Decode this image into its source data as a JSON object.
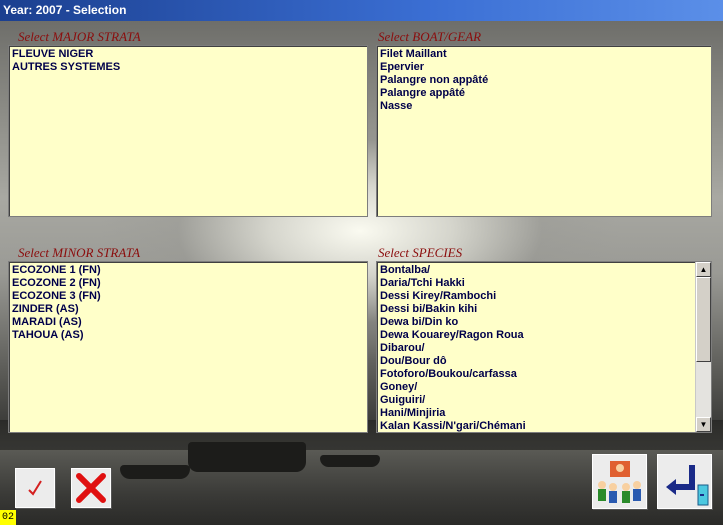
{
  "window": {
    "title": "Year: 2007 - Selection"
  },
  "major_strata": {
    "label": "Select MAJOR STRATA",
    "items": [
      "FLEUVE NIGER",
      "AUTRES SYSTEMES"
    ]
  },
  "boat_gear": {
    "label": "Select BOAT/GEAR",
    "items": [
      "Filet Maillant",
      "Epervier",
      "Palangre non appâté",
      "Palangre appâté",
      "Nasse"
    ]
  },
  "minor_strata": {
    "label": "Select MINOR STRATA",
    "items": [
      "ECOZONE 1 (FN)",
      "ECOZONE 2 (FN)",
      "ECOZONE 3 (FN)",
      "ZINDER (AS)",
      "MARADI (AS)",
      "TAHOUA (AS)"
    ]
  },
  "species": {
    "label": "Select SPECIES",
    "items": [
      "Bontalba/",
      "Daria/Tchi Hakki",
      "Dessi Kirey/Rambochi",
      "Dessi bi/Bakin kihi",
      "Dewa bi/Din ko",
      "Dewa Kouarey/Ragon Roua",
      "Dibarou/",
      "Dou/Bour dô",
      "Fotoforo/Boukou/carfassa",
      "Goney/",
      "Guiguiri/",
      "Hani/Minjiria",
      "Kalan Kassi/N'gari/Chémani"
    ]
  },
  "icons": {
    "ok": "checkmark-icon",
    "cancel": "x-icon",
    "group": "group-icon",
    "exit": "exit-icon"
  },
  "status": {
    "code": "02"
  },
  "colors": {
    "list_bg": "#ffffc9",
    "label": "#8b0d0d",
    "list_text": "#00004a",
    "title_bar": "#2a5cc8"
  }
}
